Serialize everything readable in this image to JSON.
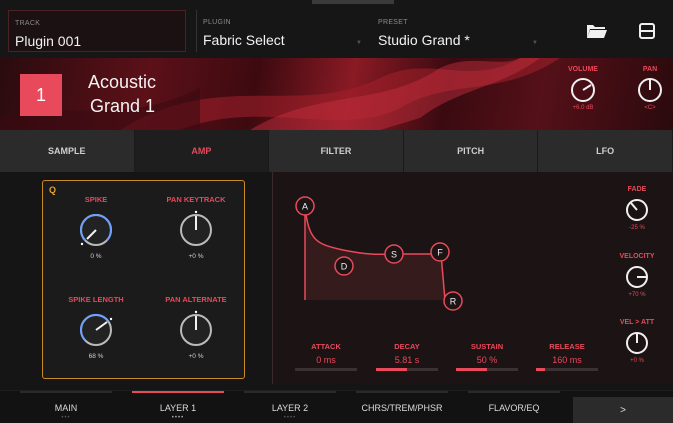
{
  "topbar": {
    "track": {
      "caption": "TRACK",
      "value": "Plugin 001"
    },
    "plugin": {
      "caption": "PLUGIN",
      "value": "Fabric Select"
    },
    "preset": {
      "caption": "PRESET",
      "value": "Studio Grand *"
    },
    "icons": [
      "folder-open-icon",
      "save-icon"
    ]
  },
  "header": {
    "number": "1",
    "name_line1": "Acoustic",
    "name_line2": "Grand 1",
    "volume": {
      "label": "VOLUME",
      "value": "+6.0 dB"
    },
    "pan": {
      "label": "PAN",
      "value": "<C>"
    }
  },
  "tabs": [
    "SAMPLE",
    "AMP",
    "FILTER",
    "PITCH",
    "LFO"
  ],
  "active_tab": "AMP",
  "q_panel": {
    "badge": "Q",
    "knobs": [
      {
        "label": "SPIKE",
        "value": "0 %"
      },
      {
        "label": "PAN KEYTRACK",
        "value": "+0 %"
      },
      {
        "label": "SPIKE LENGTH",
        "value": "68 %"
      },
      {
        "label": "PAN ALTERNATE",
        "value": "+0 %"
      }
    ]
  },
  "envelope": {
    "nodes": [
      "A",
      "D",
      "S",
      "F",
      "R"
    ],
    "controls": [
      {
        "label": "ATTACK",
        "value": "0 ms",
        "level": 0.0
      },
      {
        "label": "DECAY",
        "value": "5.81 s",
        "level": 0.5
      },
      {
        "label": "SUSTAIN",
        "value": "50 %",
        "level": 0.5
      },
      {
        "label": "RELEASE",
        "value": "160 ms",
        "level": 0.15
      }
    ]
  },
  "side_knobs": [
    {
      "label": "FADE",
      "value": "-25 %"
    },
    {
      "label": "VELOCITY",
      "value": "+70 %"
    },
    {
      "label": "VEL > ATT",
      "value": "+0 %"
    }
  ],
  "bottom_tabs": [
    {
      "label": "MAIN",
      "dots": "•••"
    },
    {
      "label": "LAYER 1",
      "dots": "••••"
    },
    {
      "label": "LAYER 2",
      "dots": "••••"
    },
    {
      "label": "CHRS/TREM/PHSR",
      "dots": ""
    },
    {
      "label": "FLAVOR/EQ",
      "dots": ""
    }
  ],
  "active_bottom_tab": "LAYER 1",
  "more_label": ">",
  "colors": {
    "accent": "#e8495b",
    "q_border": "#c98a2c",
    "background": "#151515"
  }
}
